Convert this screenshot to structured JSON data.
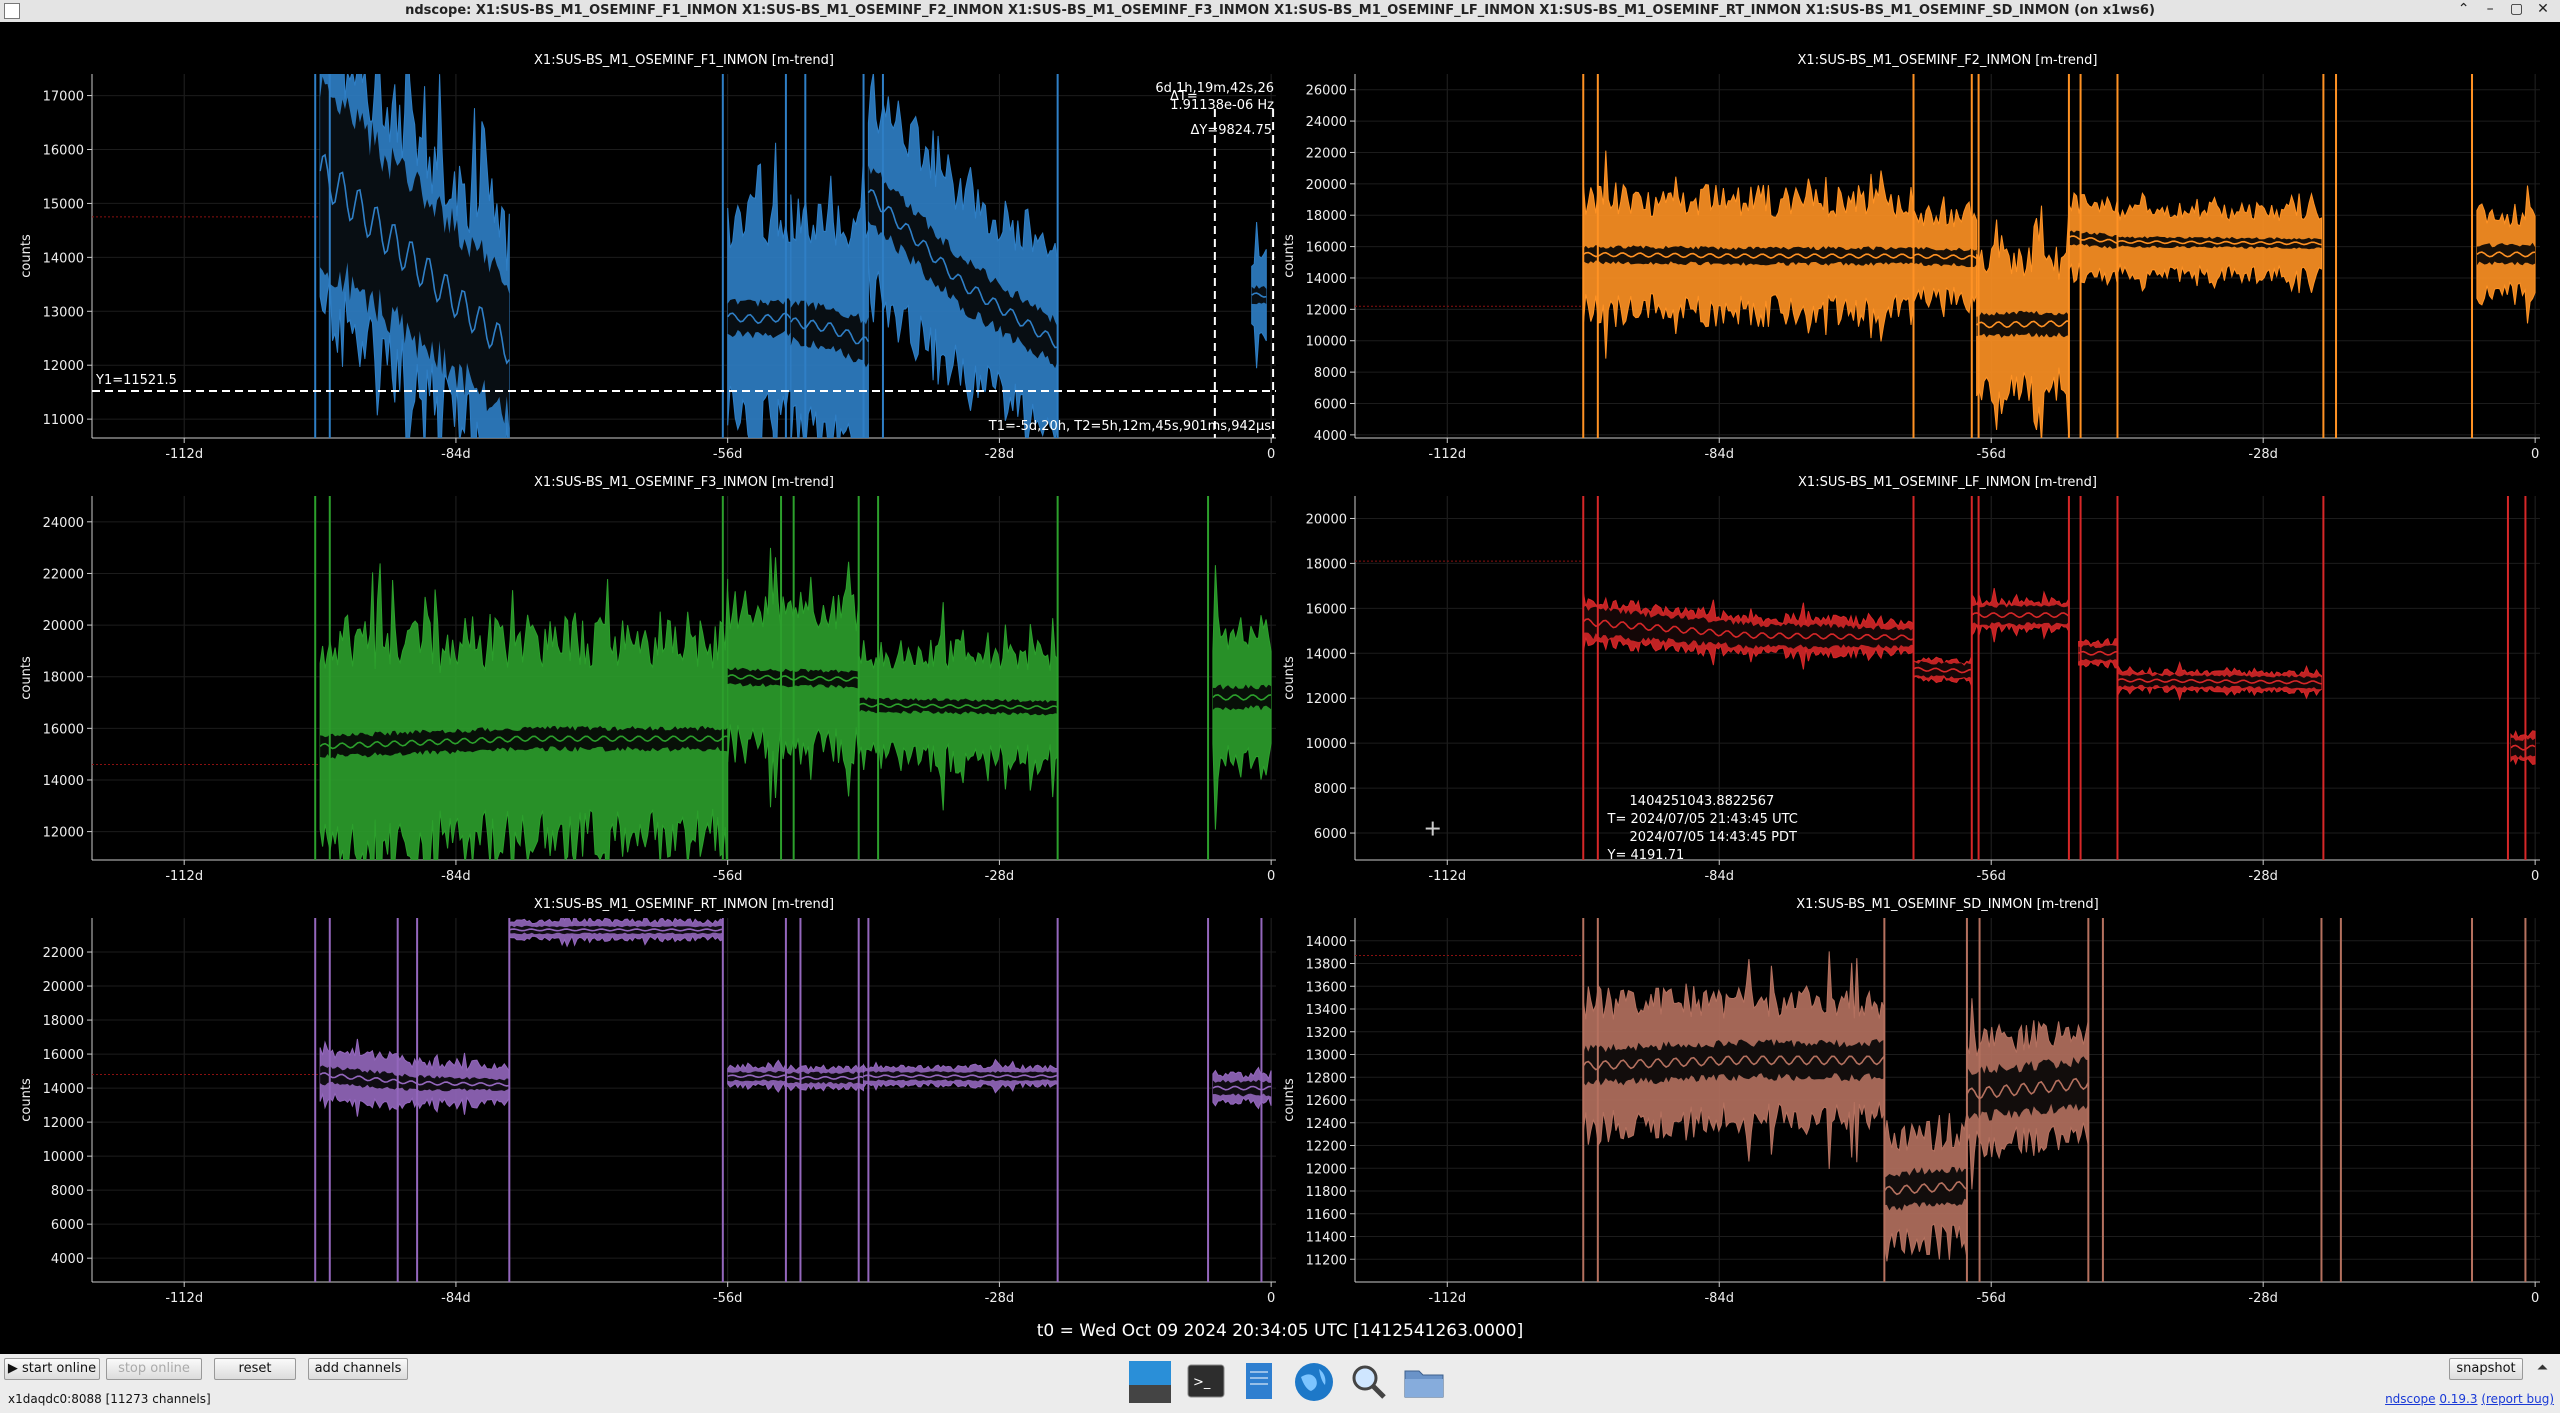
{
  "window": {
    "title": "ndscope: X1:SUS-BS_M1_OSEMINF_F1_INMON X1:SUS-BS_M1_OSEMINF_F2_INMON X1:SUS-BS_M1_OSEMINF_F3_INMON X1:SUS-BS_M1_OSEMINF_LF_INMON X1:SUS-BS_M1_OSEMINF_RT_INMON X1:SUS-BS_M1_OSEMINF_SD_INMON (on x1ws6)",
    "controls": [
      "⌃",
      "–",
      "▢",
      "✕"
    ]
  },
  "plot_x_axis": {
    "ticks": [
      "-112d",
      "-84d",
      "-56d",
      "-28d",
      "0"
    ],
    "tick_values_days": [
      -112,
      -84,
      -56,
      -28,
      0
    ],
    "range_days": [
      -121.5,
      0.5
    ]
  },
  "plots": [
    {
      "id": "f1",
      "title": "X1:SUS-BS_M1_OSEMINF_F1_INMON [m-trend]",
      "ylabel": "counts",
      "color": "#2f7fc6",
      "ylim": [
        10650,
        17400
      ],
      "yticks": [
        "11000",
        "12000",
        "13000",
        "14000",
        "15000",
        "16000",
        "17000"
      ],
      "ytick_values": [
        11000,
        12000,
        13000,
        14000,
        15000,
        16000,
        17000
      ],
      "ref_level": 14750,
      "segments": [
        {
          "x": [
            -98,
            -78.5
          ],
          "mean": [
            15600,
            13900,
            12300
          ],
          "band": [
            1600,
            1200
          ],
          "env": [
            2500,
            2000
          ]
        },
        {
          "x": [
            -56,
            -49.5
          ],
          "mean": [
            12900,
            12850,
            12900
          ],
          "band": [
            300,
            300
          ],
          "env": [
            1800,
            1900
          ]
        },
        {
          "x": [
            -49.5,
            -41.5
          ],
          "mean": [
            12800,
            12700,
            12400
          ],
          "band": [
            350,
            400
          ],
          "env": [
            1900,
            1900
          ]
        },
        {
          "x": [
            -41.5,
            -22
          ],
          "mean": [
            15200,
            13500,
            12400
          ],
          "band": [
            500,
            400
          ],
          "env": [
            1800,
            1600
          ]
        },
        {
          "x": [
            -2,
            -0.5
          ],
          "mean": [
            13300,
            13300
          ],
          "band": [
            150,
            150
          ],
          "env": [
            700,
            700
          ]
        }
      ],
      "spikes": [
        -98.5,
        -97,
        -56.5,
        -50,
        -48,
        -42,
        -40,
        -22
      ],
      "cursor": {
        "y1_label": "Y1=11521.5",
        "y1": 11521.5,
        "t1_days": -5.8,
        "t2_days": 0.2,
        "t_label": "T1=-5d,20h, T2=5h,12m,45s,901ms,942µs",
        "dt_prefix": "ΔT=",
        "dt_label": "6d,1h,19m,42s,26",
        "freq_label": "1.91138e-06 Hz",
        "dy_label": "ΔY=9824.75"
      }
    },
    {
      "id": "f2",
      "title": "X1:SUS-BS_M1_OSEMINF_F2_INMON [m-trend]",
      "ylabel": "counts",
      "color": "#ff9224",
      "ylim": [
        3800,
        27000
      ],
      "yticks": [
        "4000",
        "6000",
        "8000",
        "10000",
        "12000",
        "14000",
        "16000",
        "18000",
        "20000",
        "22000",
        "24000",
        "26000"
      ],
      "ytick_values": [
        4000,
        6000,
        8000,
        10000,
        12000,
        14000,
        16000,
        18000,
        20000,
        22000,
        24000,
        26000
      ],
      "ref_level": 12200,
      "segments": [
        {
          "x": [
            -98,
            -64
          ],
          "mean": [
            15500,
            15400,
            15400
          ],
          "band": [
            500,
            500
          ],
          "env": [
            3500,
            3500
          ]
        },
        {
          "x": [
            -64,
            -57.5
          ],
          "mean": [
            15400,
            15300
          ],
          "band": [
            500,
            500
          ],
          "env": [
            2500,
            2600
          ]
        },
        {
          "x": [
            -57.5,
            -48
          ],
          "mean": [
            11000,
            11100
          ],
          "band": [
            700,
            700
          ],
          "env": [
            4000,
            4000
          ]
        },
        {
          "x": [
            -48,
            -43
          ],
          "mean": [
            16600,
            16300
          ],
          "band": [
            400,
            400
          ],
          "env": [
            2200,
            2200
          ]
        },
        {
          "x": [
            -43,
            -22
          ],
          "mean": [
            16300,
            16200
          ],
          "band": [
            300,
            300
          ],
          "env": [
            2000,
            2000
          ]
        },
        {
          "x": [
            -6,
            0
          ],
          "mean": [
            15500,
            15500
          ],
          "band": [
            600,
            600
          ],
          "env": [
            2500,
            2500
          ]
        }
      ],
      "spikes": [
        -98,
        -96.5,
        -64,
        -58,
        -57.3,
        -48,
        -46.8,
        -43,
        -21.8,
        -20.5,
        -6.5
      ],
      "cursor": null
    },
    {
      "id": "f3",
      "title": "X1:SUS-BS_M1_OSEMINF_F3_INMON [m-trend]",
      "ylabel": "counts",
      "color": "#2ca02c",
      "ylim": [
        10900,
        25000
      ],
      "yticks": [
        "12000",
        "14000",
        "16000",
        "18000",
        "20000",
        "22000",
        "24000"
      ],
      "ytick_values": [
        12000,
        14000,
        16000,
        18000,
        20000,
        22000,
        24000
      ],
      "ref_level": 14600,
      "segments": [
        {
          "x": [
            -98,
            -56
          ],
          "mean": [
            15300,
            15600,
            15600
          ],
          "band": [
            400,
            400
          ],
          "env": [
            3800,
            3800
          ]
        },
        {
          "x": [
            -56,
            -42.5
          ],
          "mean": [
            18000,
            17900
          ],
          "band": [
            300,
            300
          ],
          "env": [
            2600,
            2600
          ]
        },
        {
          "x": [
            -42.5,
            -22
          ],
          "mean": [
            16900,
            16800
          ],
          "band": [
            250,
            250
          ],
          "env": [
            2000,
            2000
          ]
        },
        {
          "x": [
            -6,
            0
          ],
          "mean": [
            17200,
            17200
          ],
          "band": [
            400,
            400
          ],
          "env": [
            2500,
            2500
          ]
        }
      ],
      "spikes": [
        -98.5,
        -97,
        -56.5,
        -50.5,
        -49.2,
        -42.5,
        -40.5,
        -22,
        -6.5
      ],
      "cursor": null
    },
    {
      "id": "lf",
      "title": "X1:SUS-BS_M1_OSEMINF_LF_INMON [m-trend]",
      "ylabel": "counts",
      "color": "#d62728",
      "ylim": [
        4800,
        21000
      ],
      "yticks": [
        "6000",
        "8000",
        "10000",
        "12000",
        "14000",
        "16000",
        "18000",
        "20000"
      ],
      "ytick_values": [
        6000,
        8000,
        10000,
        12000,
        14000,
        16000,
        18000,
        20000
      ],
      "ref_level": 18100,
      "segments": [
        {
          "x": [
            -98,
            -64
          ],
          "mean": [
            15400,
            14800,
            14700
          ],
          "band": [
            600,
            400
          ],
          "env": [
            900,
            700
          ]
        },
        {
          "x": [
            -64,
            -58
          ],
          "mean": [
            13300,
            13200
          ],
          "band": [
            300,
            300
          ],
          "env": [
            400,
            400
          ]
        },
        {
          "x": [
            -58,
            -48
          ],
          "mean": [
            15700,
            15700
          ],
          "band": [
            400,
            400
          ],
          "env": [
            600,
            600
          ]
        },
        {
          "x": [
            -47,
            -43
          ],
          "mean": [
            14000,
            14000
          ],
          "band": [
            300,
            300
          ],
          "env": [
            500,
            500
          ]
        },
        {
          "x": [
            -43,
            -22
          ],
          "mean": [
            12800,
            12700
          ],
          "band": [
            250,
            250
          ],
          "env": [
            400,
            400
          ]
        },
        {
          "x": [
            -2.5,
            0
          ],
          "mean": [
            9800,
            9800
          ],
          "band": [
            400,
            400
          ],
          "env": [
            600,
            600
          ]
        }
      ],
      "spikes": [
        -98,
        -96.5,
        -64,
        -58,
        -57.3,
        -48,
        -46.8,
        -43,
        -21.8,
        -2.8,
        -1
      ],
      "cursor": null,
      "hover": {
        "crosshair_days": -113.5,
        "crosshair_value": 6200,
        "lines": [
          "1404251043.8822567",
          "T= 2024/07/05 21:43:45 UTC",
          "2024/07/05 14:43:45 PDT",
          "Y= 4191.71"
        ]
      }
    },
    {
      "id": "rt",
      "title": "X1:SUS-BS_M1_OSEMINF_RT_INMON [m-trend]",
      "ylabel": "counts",
      "color": "#9467bd",
      "ylim": [
        2600,
        24000
      ],
      "yticks": [
        "4000",
        "6000",
        "8000",
        "10000",
        "12000",
        "14000",
        "16000",
        "18000",
        "20000",
        "22000"
      ],
      "ytick_values": [
        4000,
        6000,
        8000,
        10000,
        12000,
        14000,
        16000,
        18000,
        20000,
        22000
      ],
      "ref_level": 14800,
      "segments": [
        {
          "x": [
            -98,
            -78.5
          ],
          "mean": [
            14800,
            14300,
            14200
          ],
          "band": [
            500,
            300
          ],
          "env": [
            1500,
            1000
          ]
        },
        {
          "x": [
            -78.5,
            -56.5
          ],
          "mean": [
            23300,
            23300
          ],
          "band": [
            200,
            200
          ],
          "env": [
            500,
            500
          ]
        },
        {
          "x": [
            -56,
            -50
          ],
          "mean": [
            14700,
            14700
          ],
          "band": [
            250,
            250
          ],
          "env": [
            600,
            600
          ]
        },
        {
          "x": [
            -50,
            -42
          ],
          "mean": [
            14600,
            14600
          ],
          "band": [
            300,
            300
          ],
          "env": [
            600,
            600
          ]
        },
        {
          "x": [
            -42,
            -22
          ],
          "mean": [
            14700,
            14700
          ],
          "band": [
            250,
            250
          ],
          "env": [
            500,
            500
          ]
        },
        {
          "x": [
            -6,
            0
          ],
          "mean": [
            14000,
            14000
          ],
          "band": [
            400,
            400
          ],
          "env": [
            800,
            800
          ]
        }
      ],
      "spikes": [
        -98.5,
        -97,
        -90,
        -88,
        -78.5,
        -56.5,
        -50,
        -48.5,
        -42.5,
        -41.5,
        -22,
        -6.5,
        -1
      ],
      "cursor": null
    },
    {
      "id": "sd",
      "title": "X1:SUS-BS_M1_OSEMINF_SD_INMON [m-trend]",
      "ylabel": "counts",
      "color": "#b5715f",
      "ylim": [
        11000,
        14200
      ],
      "yticks": [
        "11200",
        "11400",
        "11600",
        "11800",
        "12000",
        "12200",
        "12400",
        "12600",
        "12800",
        "13000",
        "13200",
        "13400",
        "13600",
        "13800",
        "14000"
      ],
      "ytick_values": [
        11200,
        11400,
        11600,
        11800,
        12000,
        12200,
        12400,
        12600,
        12800,
        13000,
        13200,
        13400,
        13600,
        13800,
        14000
      ],
      "ref_level": 13870,
      "segments": [
        {
          "x": [
            -98,
            -67
          ],
          "mean": [
            12900,
            12950,
            12950
          ],
          "band": [
            150,
            150
          ],
          "env": [
            550,
            500
          ]
        },
        {
          "x": [
            -67,
            -58.5
          ],
          "mean": [
            11800,
            11850
          ],
          "band": [
            150,
            150
          ],
          "env": [
            450,
            450
          ]
        },
        {
          "x": [
            -58.5,
            -46
          ],
          "mean": [
            12650,
            12750
          ],
          "band": [
            200,
            200
          ],
          "env": [
            450,
            450
          ]
        }
      ],
      "spikes": [
        -98,
        -96.5,
        -67,
        -58.5,
        -57.2,
        -46,
        -44.5,
        -22,
        -20,
        -6.5,
        -1
      ],
      "cursor": null
    }
  ],
  "t0_label": "t0 = Wed Oct 09 2024 20:34:05 UTC [1412541263.0000]",
  "bottom": {
    "start_online": "▶ start online",
    "stop_online": "stop online",
    "reset": "reset",
    "add_channels": "add channels",
    "snapshot": "snapshot",
    "collapse_glyph": "⏶",
    "status": "x1daqdc0:8088  [11273 channels]",
    "version_prefix": "ndscope",
    "version": "0.19.3",
    "report_bug": "(report bug)",
    "dock_icons": [
      "desktop-icon",
      "terminal-icon",
      "text-editor-icon",
      "web-browser-icon",
      "search-icon",
      "file-manager-icon"
    ]
  }
}
